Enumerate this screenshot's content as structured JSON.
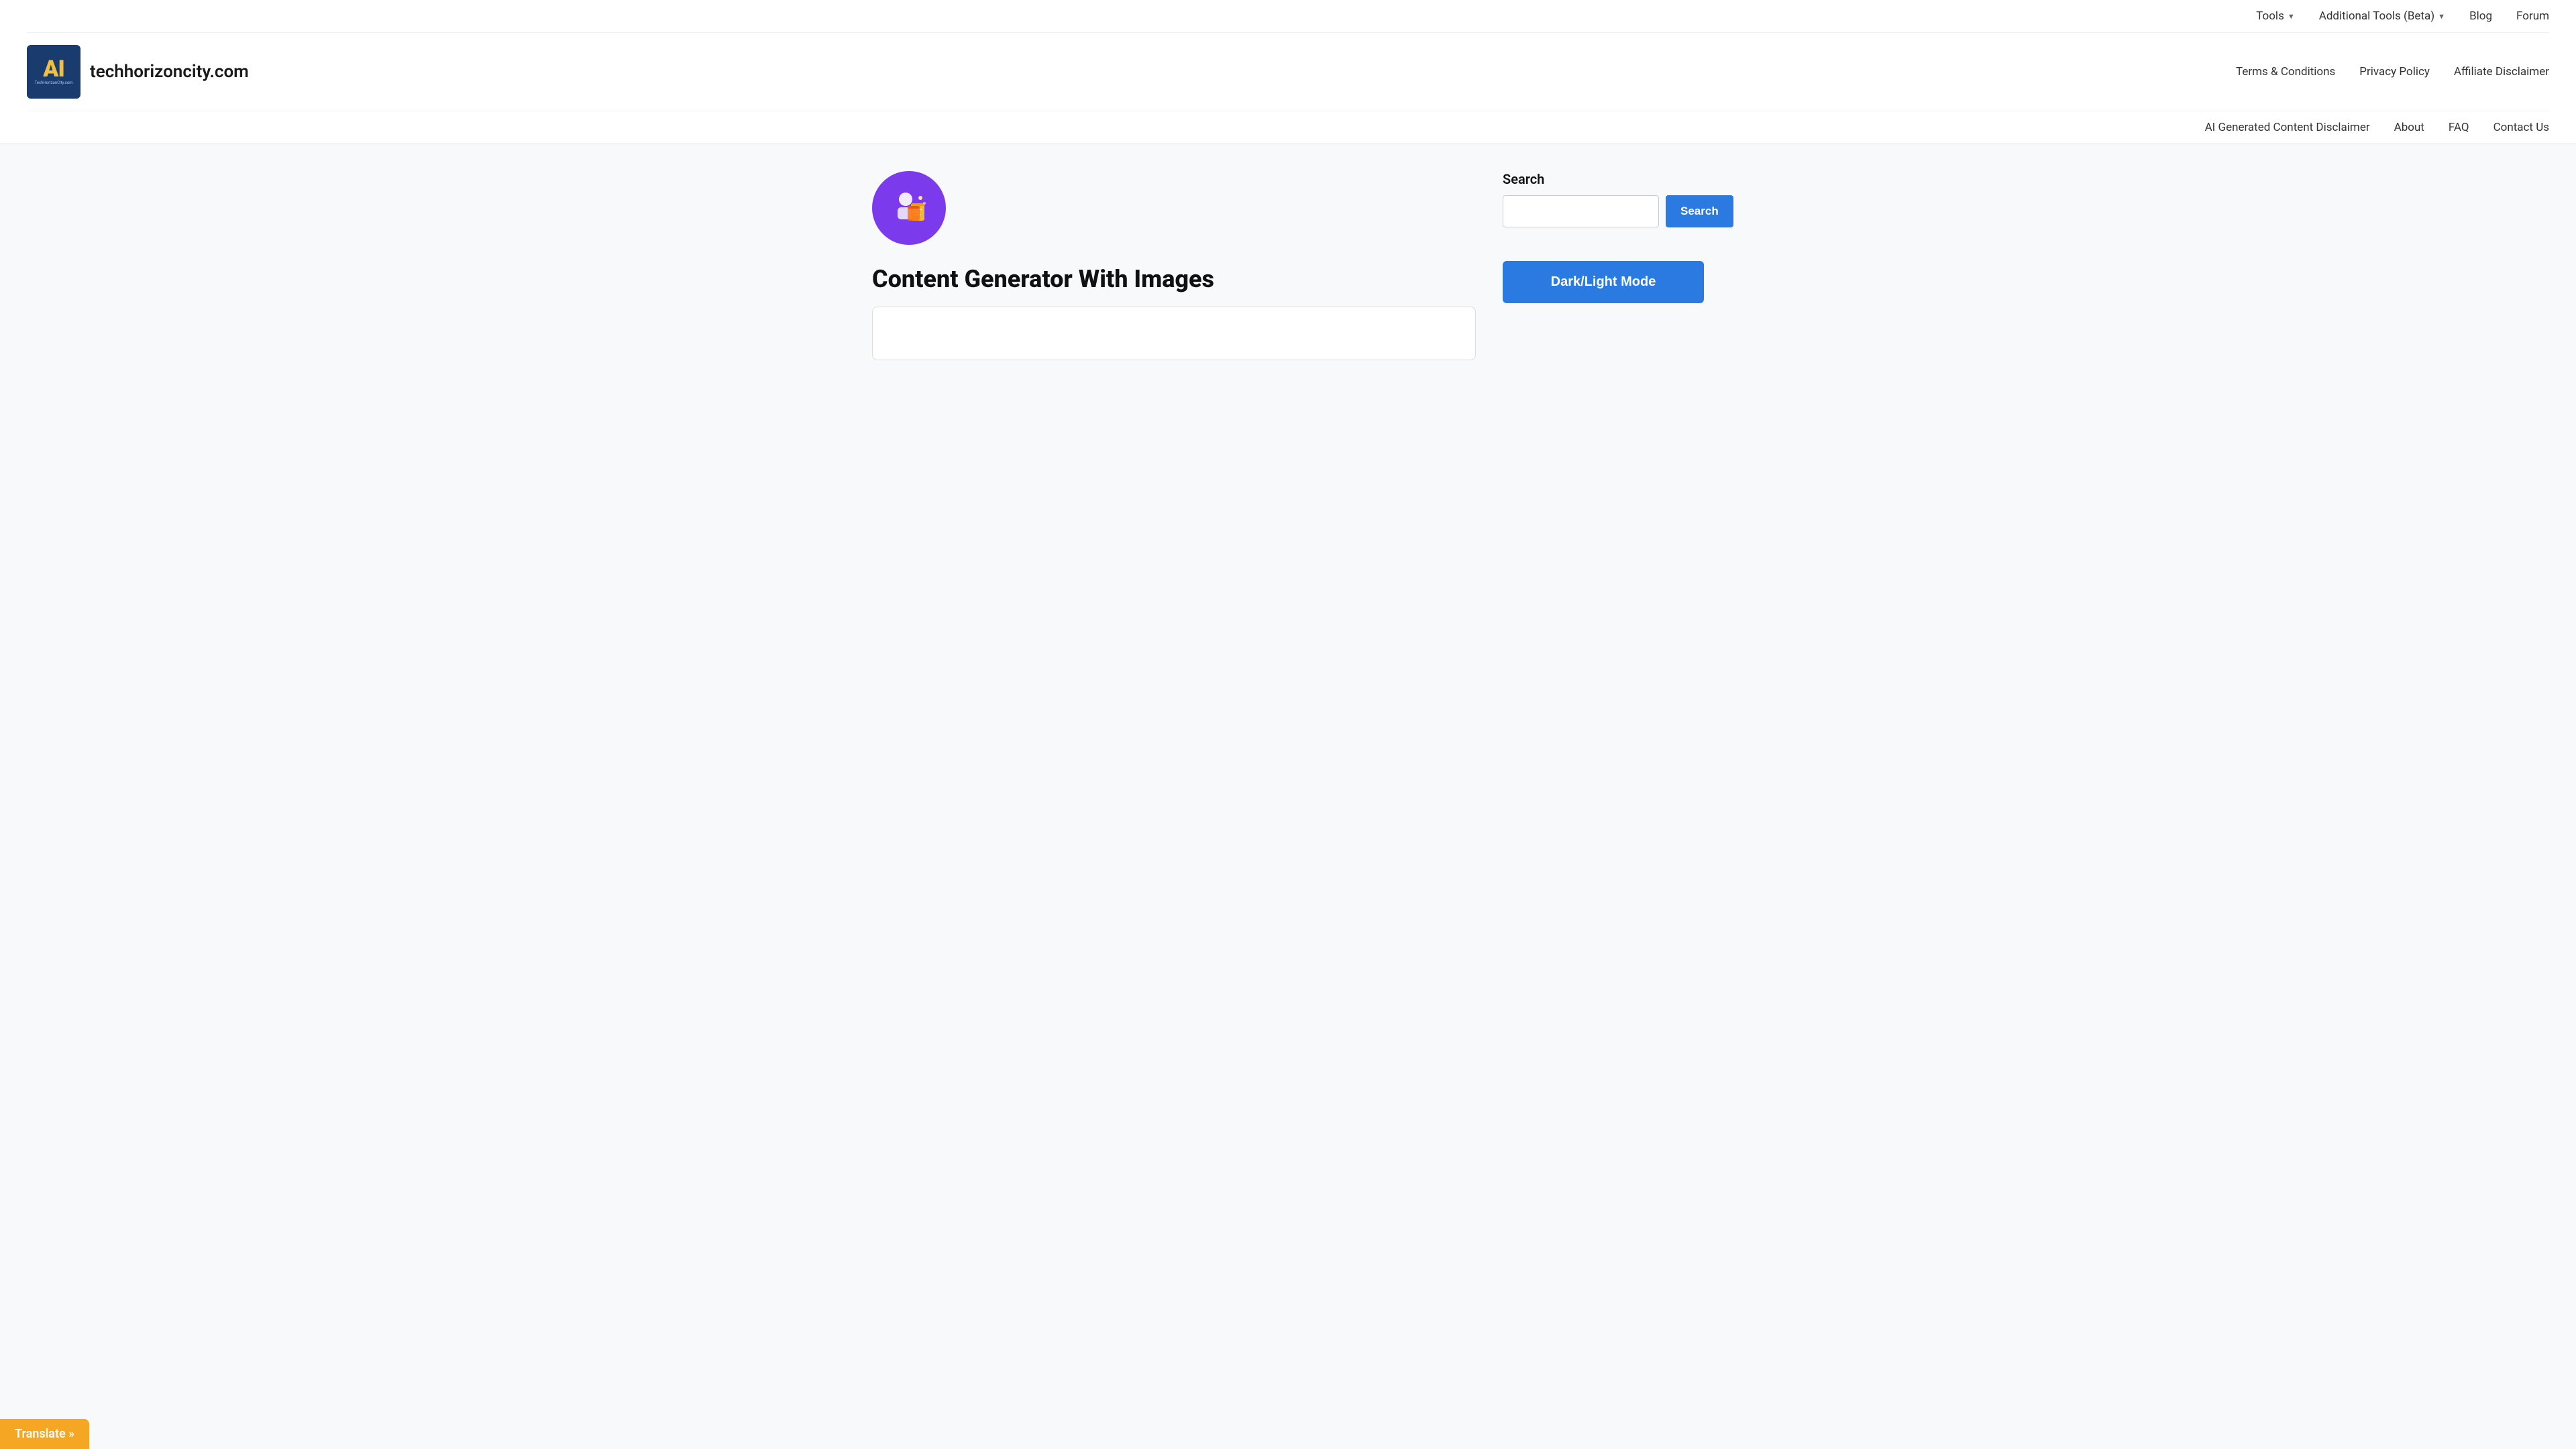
{
  "header": {
    "logo": {
      "ai_text": "AI",
      "sub_text": "TechHorizonCity.com"
    },
    "site_name": "techhorizoncity.com",
    "top_nav": {
      "tools_label": "Tools",
      "additional_tools_label": "Additional Tools (Beta)",
      "blog_label": "Blog",
      "forum_label": "Forum"
    },
    "middle_nav": {
      "terms_label": "Terms & Conditions",
      "privacy_label": "Privacy Policy",
      "affiliate_label": "Affiliate Disclaimer"
    },
    "bottom_nav": {
      "ai_disclaimer_label": "AI Generated Content Disclaimer",
      "about_label": "About",
      "faq_label": "FAQ",
      "contact_label": "Contact Us"
    }
  },
  "main": {
    "page_title": "Content Generator With Images",
    "form_placeholder": ""
  },
  "sidebar": {
    "search_label": "Search",
    "search_placeholder": "",
    "search_button_label": "Search",
    "dark_light_button_label": "Dark/Light Mode"
  },
  "translate": {
    "label": "Translate »"
  },
  "colors": {
    "accent_blue": "#2a7ae2",
    "logo_bg": "#1a3b6e",
    "logo_text": "#f0c040",
    "icon_circle": "#7c3aed",
    "translate_bg": "#f5a623"
  }
}
